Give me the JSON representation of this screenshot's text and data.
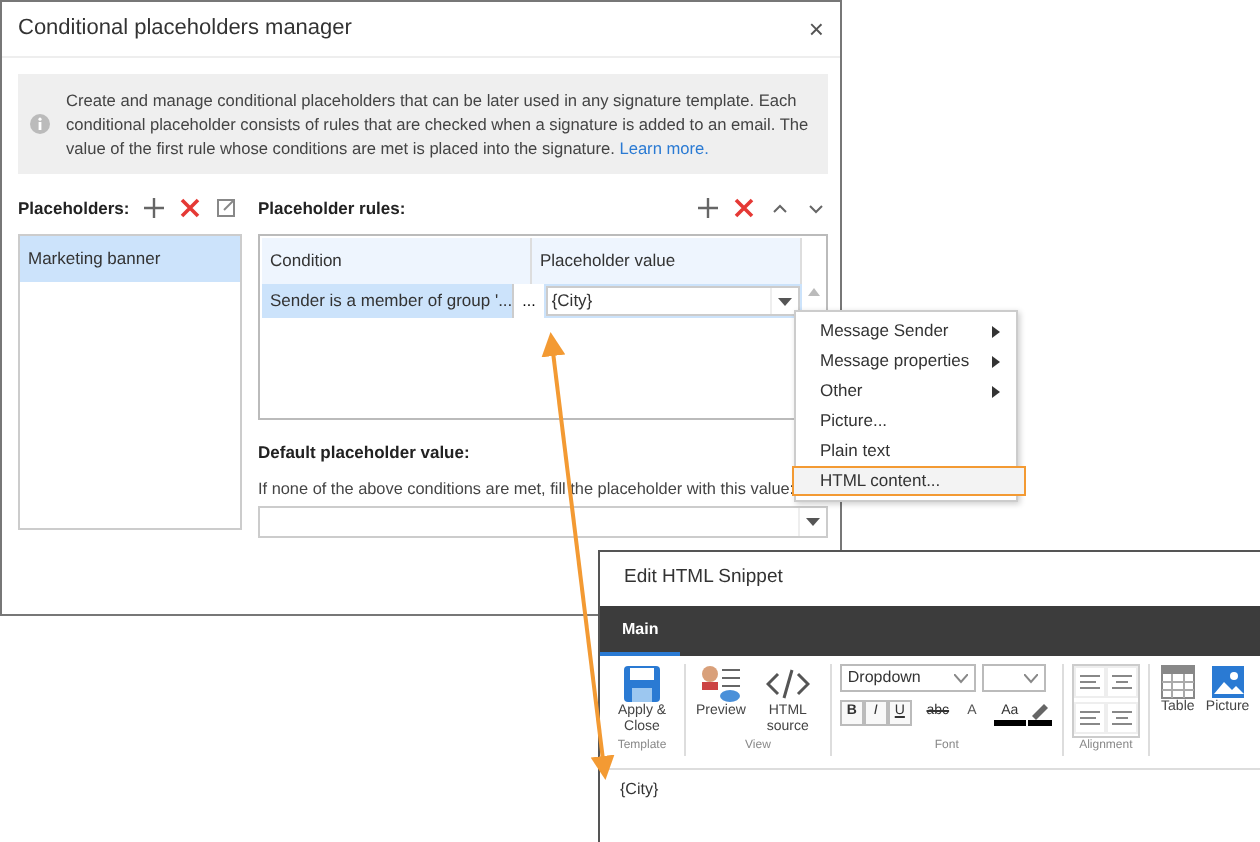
{
  "dialog": {
    "title": "Conditional placeholders manager",
    "close": "×",
    "info": "Create and manage conditional placeholders that can be later used in any signature template. Each conditional placeholder consists of rules that are checked when a signature is added to an email. The value of the first rule whose conditions are met is placed into the signature.",
    "info_link": "Learn more.",
    "placeholders": {
      "label": "Placeholders:",
      "items": [
        {
          "label": "Marketing banner",
          "selected": true
        }
      ]
    },
    "rules": {
      "label": "Placeholder rules:",
      "columns": [
        "Condition",
        "Placeholder value"
      ],
      "rows": [
        {
          "condition": "Sender is a member of group '...",
          "ellipsis_button": "...",
          "value": "{City}",
          "selected": true
        }
      ],
      "default_label": "Default placeholder value:",
      "default_hint": "If none of the above conditions are met, fill the placeholder with this value:"
    }
  },
  "menu": {
    "items": [
      {
        "label": "Message Sender",
        "submenu": true,
        "highlighted": false
      },
      {
        "label": "Message properties",
        "submenu": true,
        "highlighted": false
      },
      {
        "label": "Other",
        "submenu": true,
        "highlighted": false
      },
      {
        "label": "Picture...",
        "submenu": false,
        "highlighted": false
      },
      {
        "label": "Plain text",
        "submenu": false,
        "highlighted": false
      },
      {
        "label": "HTML content...",
        "submenu": false,
        "highlighted": true
      }
    ]
  },
  "snippet": {
    "title": "Edit HTML Snippet",
    "tabs": [
      {
        "label": "Main",
        "selected": true
      }
    ],
    "groups": [
      {
        "label": "Template",
        "buttons": [
          {
            "kind": "save",
            "label": "Apply & Close"
          }
        ]
      },
      {
        "label": "View",
        "buttons": [
          {
            "kind": "preview",
            "label": "Preview"
          },
          {
            "kind": "code",
            "label": "HTML source"
          }
        ]
      },
      {
        "label": "Font",
        "buttons": [
          {
            "kind": "font"
          }
        ]
      },
      {
        "label": "Alignment",
        "buttons": [
          {
            "kind": "align"
          }
        ]
      },
      {
        "buttons": [
          {
            "kind": "table",
            "label": "Table"
          },
          {
            "kind": "picture",
            "label": "Picture"
          }
        ]
      }
    ],
    "font_dropdown": "Dropdown",
    "format_buttons": [
      "B",
      "I",
      "U",
      "abc"
    ],
    "swatch_text": "Aa",
    "style_text": "A",
    "content": "{City}"
  }
}
